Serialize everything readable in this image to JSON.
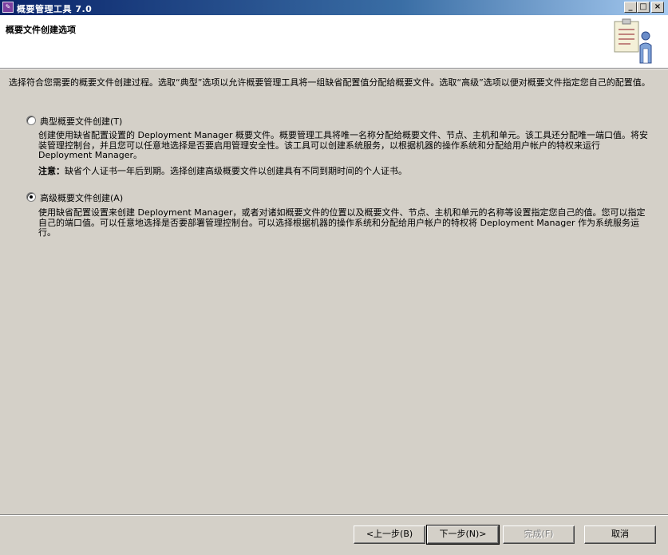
{
  "window": {
    "title": "概要管理工具 7.0",
    "icon": "wizard-app-icon",
    "controls": {
      "minimize": "_",
      "maximize": "□",
      "close": "×"
    }
  },
  "header": {
    "title": "概要文件创建选项",
    "illustration": "clipboard-person-icon"
  },
  "intro_text": "选择符合您需要的概要文件创建过程。选取“典型”选项以允许概要管理工具将一组缺省配置值分配给概要文件。选取“高级”选项以便对概要文件指定您自己的配置值。",
  "options": {
    "typical": {
      "label": "典型概要文件创建(T)",
      "selected": false,
      "description": "创建使用缺省配置设置的 Deployment Manager 概要文件。概要管理工具将唯一名称分配给概要文件、节点、主机和单元。该工具还分配唯一端口值。将安装管理控制台，并且您可以任意地选择是否要启用管理安全性。该工具可以创建系统服务，以根据机器的操作系统和分配给用户帐户的特权来运行 Deployment Manager。",
      "note_label": "注意：",
      "note_text": "缺省个人证书一年后到期。选择创建高级概要文件以创建具有不同到期时间的个人证书。"
    },
    "advanced": {
      "label": "高级概要文件创建(A)",
      "selected": true,
      "description": "使用缺省配置设置来创建 Deployment Manager，或者对诸如概要文件的位置以及概要文件、节点、主机和单元的名称等设置指定您自己的值。您可以指定自己的端口值。可以任意地选择是否要部署管理控制台。可以选择根据机器的操作系统和分配给用户帐户的特权将 Deployment Manager 作为系统服务运行。"
    }
  },
  "buttons": {
    "back": "<上一步(B)",
    "next": "下一步(N)>",
    "finish": "完成(F)",
    "cancel": "取消"
  }
}
